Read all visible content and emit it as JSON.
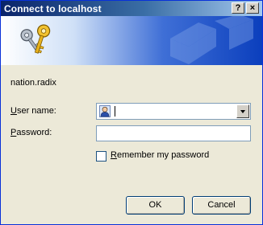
{
  "window": {
    "title": "Connect to localhost",
    "help_label": "?",
    "close_label": "×"
  },
  "server": {
    "text": "nation.radix"
  },
  "form": {
    "username_label_u": "U",
    "username_label_rest": "ser name:",
    "username_value": "",
    "password_label_u": "P",
    "password_label_rest": "assword:",
    "remember_label_u": "R",
    "remember_label_rest": "emember my password",
    "remember_checked": false
  },
  "buttons": {
    "ok_label": "OK",
    "cancel_label": "Cancel"
  },
  "icons": {
    "banner": "keys-icon",
    "watermark": "network-watermark-icon",
    "user": "user-icon",
    "dropdown": "chevron-down-icon"
  },
  "colors": {
    "title_bar": "#0a246a",
    "banner_blue": "#0b3fbd",
    "dialog_bg": "#ece9d8",
    "field_border": "#7f9db9"
  }
}
